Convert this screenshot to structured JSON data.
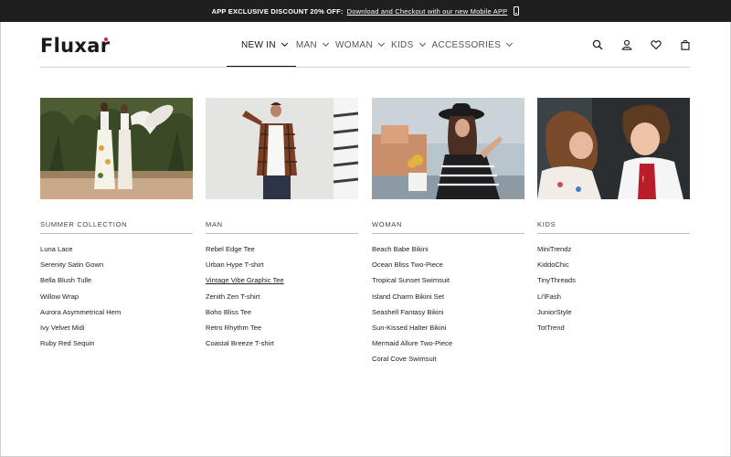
{
  "promo": {
    "strong_text": "APP EXCLUSIVE DISCOUNT 20% OFF:",
    "link_text": "Download and Checkout with our new Mobile APP",
    "icon": "phone-icon"
  },
  "header": {
    "logo": "Fluxar",
    "nav": [
      {
        "label": "NEW IN",
        "active": true
      },
      {
        "label": "MAN"
      },
      {
        "label": "WOMAN"
      },
      {
        "label": "KIDS"
      },
      {
        "label": "ACCESSORIES"
      }
    ],
    "icons": [
      "search-icon",
      "user-icon",
      "heart-icon",
      "bag-icon"
    ]
  },
  "menu": {
    "columns": [
      {
        "heading": "SUMMER COLLECTION",
        "image": "summer-collection-photo",
        "items": [
          "Luna Lace",
          "Serenity Satin Gown",
          "Bella Blush Tulle",
          "Willow Wrap",
          "Aurora Asymmetrical Hem",
          "Ivy Velvet Midi",
          "Ruby Red Sequin"
        ]
      },
      {
        "heading": "MAN",
        "image": "man-photo",
        "items": [
          "Rebel Edge Tee",
          "Urban Hype T-shirt",
          "Vintage Vibe Graphic Tee",
          "Zenith Zen T-shirt",
          "Boho Bliss Tee",
          "Retro Rhythm Tee",
          "Coastal Breeze T-shirt"
        ],
        "hovered_item": "Vintage Vibe Graphic Tee"
      },
      {
        "heading": "WOMAN",
        "image": "woman-photo",
        "items": [
          "Beach Babe Bikini",
          "Ocean Bliss Two-Piece",
          "Tropical Sunset Swimsuit",
          "Island Charm Bikini Set",
          "Seashell Fantasy Bikini",
          "Sun-Kissed Halter Bikini",
          "Mermaid Allure Two-Piece",
          "Coral Cove Swimsuit"
        ]
      },
      {
        "heading": "KIDS",
        "image": "kids-photo",
        "items": [
          "MiniTrendz",
          "KiddoChic",
          "TinyThreads",
          "Li'lFash",
          "JuniorStyle",
          "TotTrend"
        ]
      }
    ]
  },
  "colors": {
    "promo_bg": "#1f1f1f",
    "logo_dot": "#e0232e",
    "text": "#222222",
    "divider": "#cfcfcf"
  }
}
